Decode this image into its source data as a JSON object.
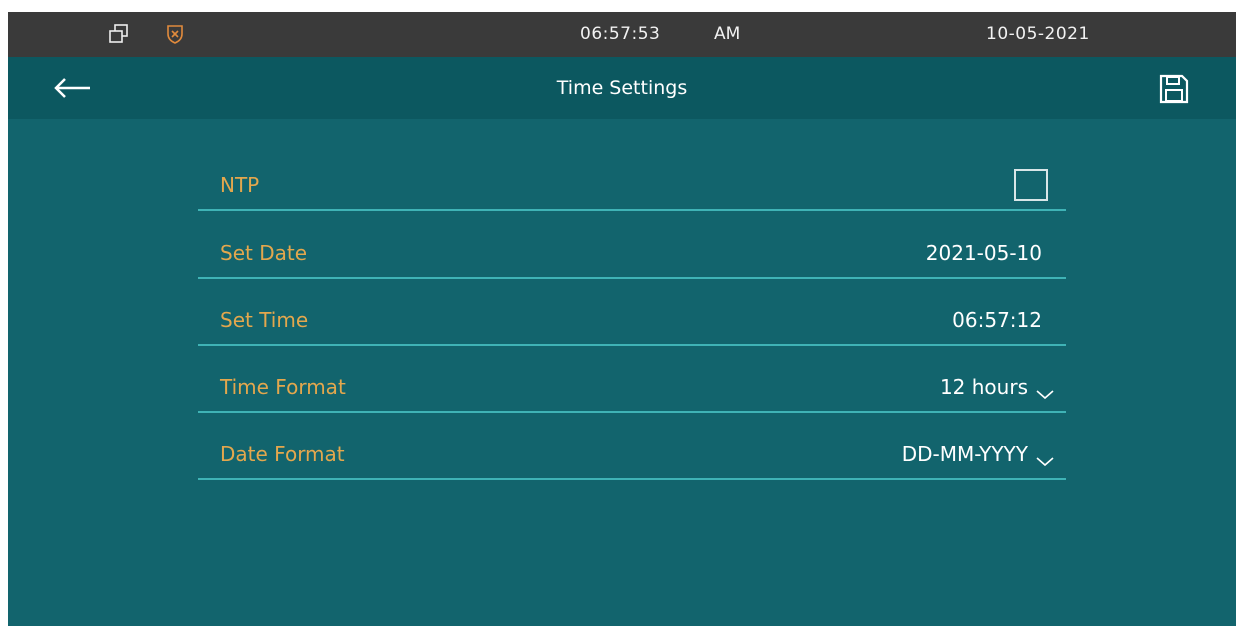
{
  "status_bar": {
    "time": "06:57:53",
    "ampm": "AM",
    "date": "10-05-2021",
    "icons": [
      "windows-icon",
      "shield-alarm-icon"
    ]
  },
  "header": {
    "title": "Time Settings",
    "back_icon": "back-arrow-icon",
    "save_icon": "save-icon"
  },
  "settings": {
    "ntp": {
      "label": "NTP",
      "checked": false
    },
    "set_date": {
      "label": "Set Date",
      "value": "2021-05-10"
    },
    "set_time": {
      "label": "Set Time",
      "value": "06:57:12"
    },
    "time_format": {
      "label": "Time Format",
      "value": "12 hours"
    },
    "date_format": {
      "label": "Date Format",
      "value": "DD-MM-YYYY"
    }
  },
  "colors": {
    "background": "#12646d",
    "header": "#0c5860",
    "status_bar": "#3a3a3a",
    "label": "#e3a74d",
    "divider": "#3fb3b6",
    "shield_icon": "#e08a3c"
  }
}
